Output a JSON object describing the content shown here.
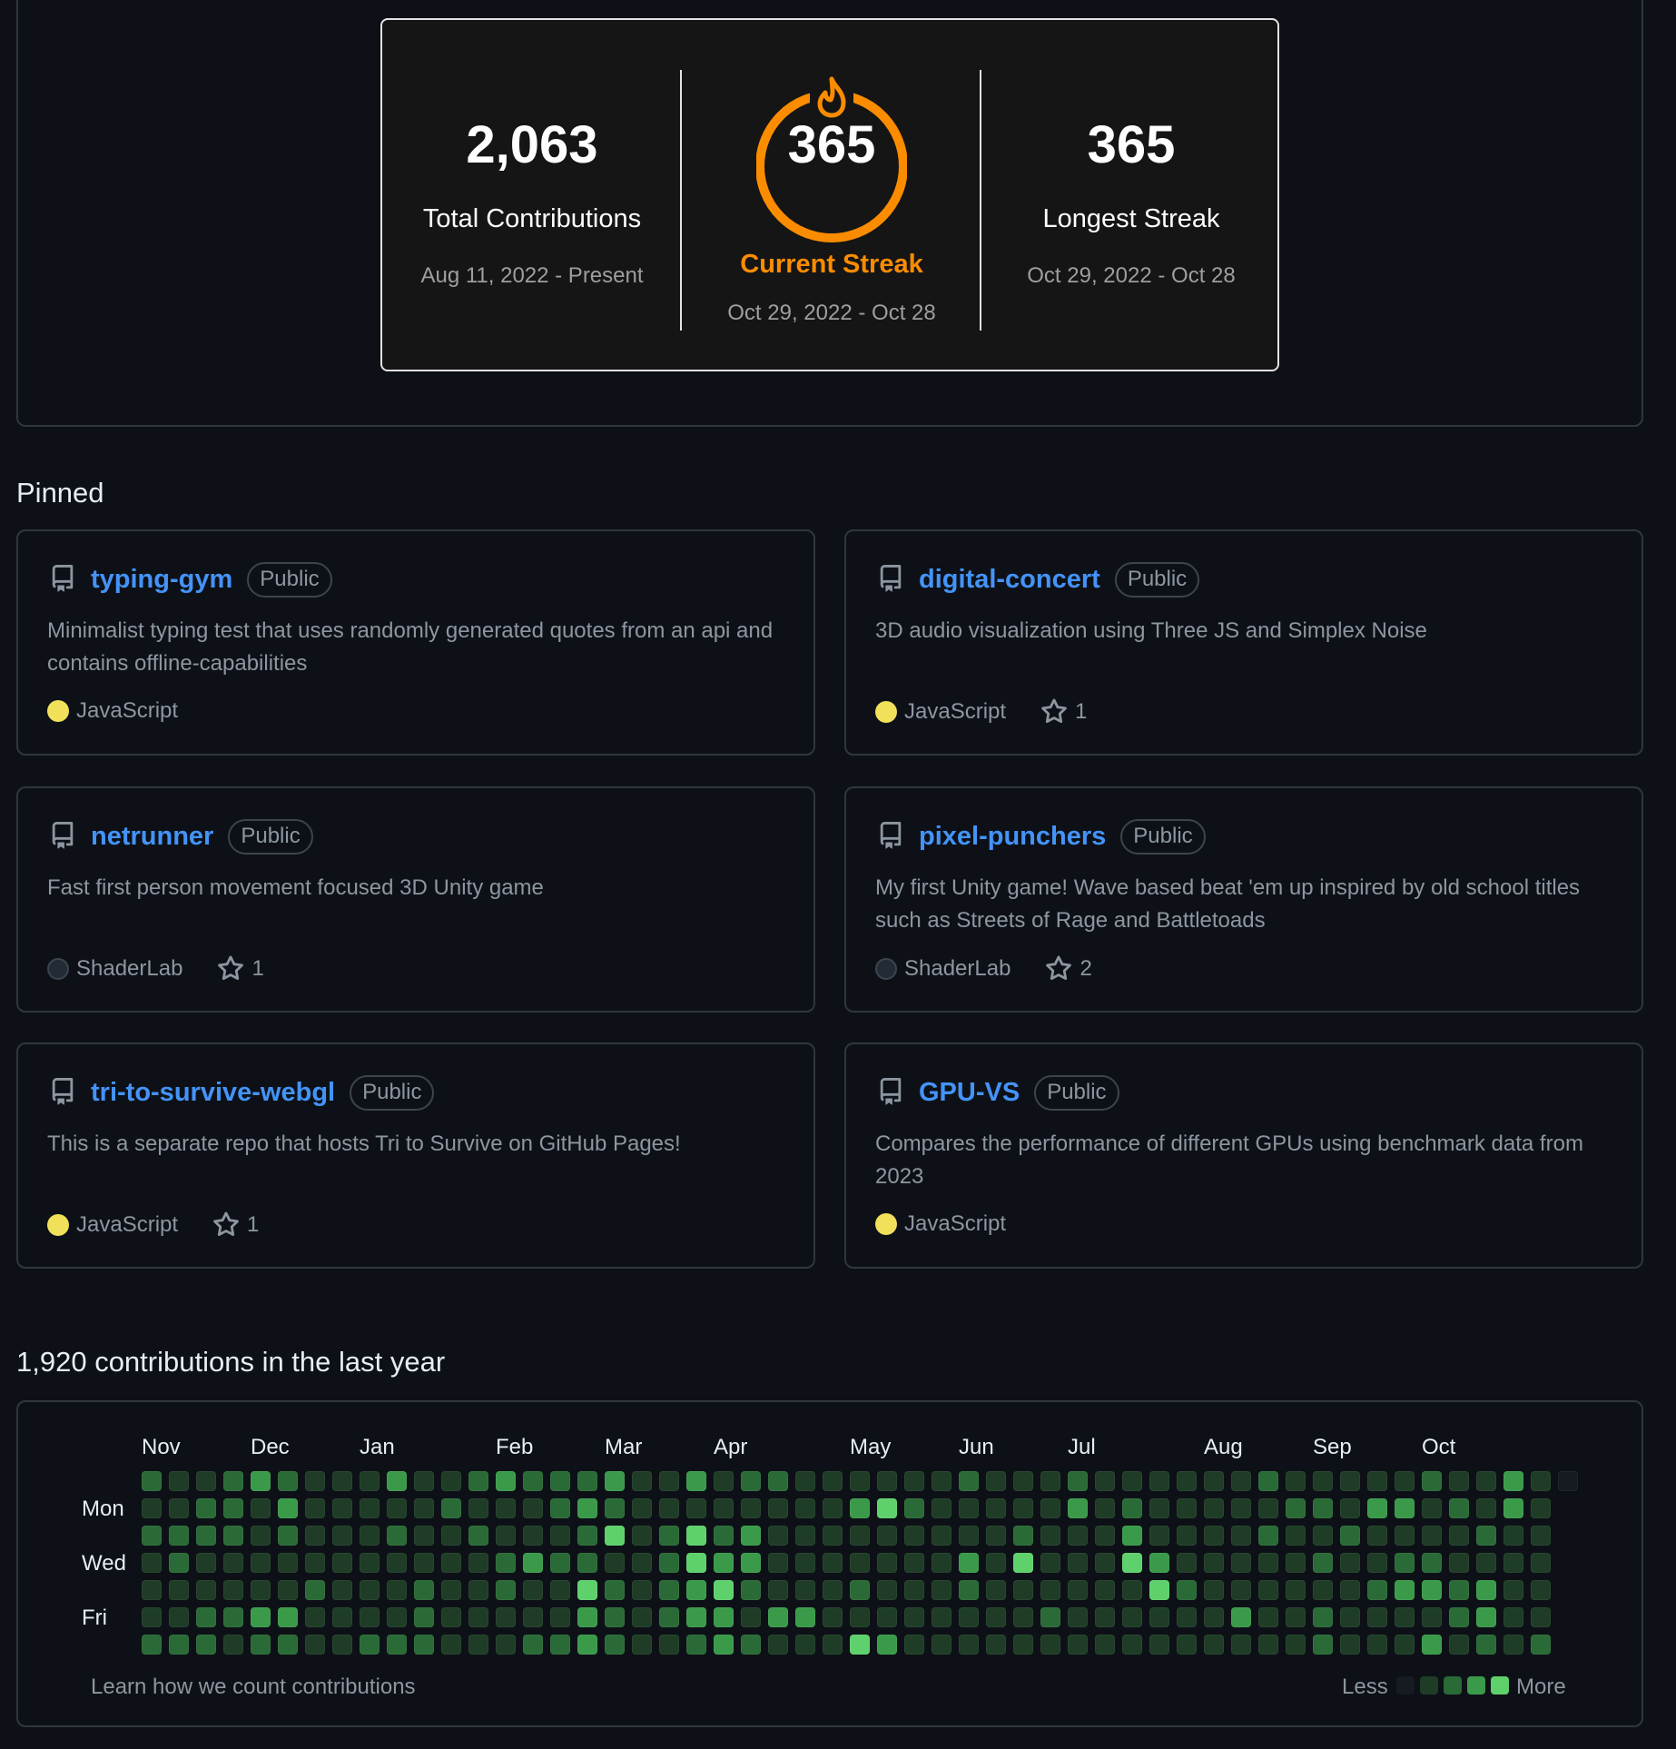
{
  "streak": {
    "total": {
      "value": "2,063",
      "label": "Total Contributions",
      "range": "Aug 11, 2022 - Present"
    },
    "current": {
      "value": "365",
      "label": "Current Streak",
      "range": "Oct 29, 2022 - Oct 28"
    },
    "longest": {
      "value": "365",
      "label": "Longest Streak",
      "range": "Oct 29, 2022 - Oct 28"
    },
    "colors": {
      "ring": "#fb8c00",
      "card_bg": "#151515",
      "card_border": "#e4e2e2"
    }
  },
  "pinned": {
    "title": "Pinned",
    "repos": [
      {
        "name": "typing-gym",
        "visibility": "Public",
        "description": "Minimalist typing test that uses randomly generated quotes from an api and contains offline-capabilities",
        "language": "JavaScript",
        "stars": ""
      },
      {
        "name": "digital-concert",
        "visibility": "Public",
        "description": "3D audio visualization using Three JS and Simplex Noise",
        "language": "JavaScript",
        "stars": "1"
      },
      {
        "name": "netrunner",
        "visibility": "Public",
        "description": "Fast first person movement focused 3D Unity game",
        "language": "ShaderLab",
        "stars": "1"
      },
      {
        "name": "pixel-punchers",
        "visibility": "Public",
        "description": "My first Unity game! Wave based beat 'em up inspired by old school titles such as Streets of Rage and Battletoads",
        "language": "ShaderLab",
        "stars": "2"
      },
      {
        "name": "tri-to-survive-webgl",
        "visibility": "Public",
        "description": "This is a separate repo that hosts Tri to Survive on GitHub Pages!",
        "language": "JavaScript",
        "stars": "1"
      },
      {
        "name": "GPU-VS",
        "visibility": "Public",
        "description": "Compares the performance of different GPUs using benchmark data from 2023",
        "language": "JavaScript",
        "stars": ""
      }
    ]
  },
  "contributions": {
    "title": "1,920 contributions in the last year",
    "months": [
      "Nov",
      "Dec",
      "Jan",
      "Feb",
      "Mar",
      "Apr",
      "May",
      "Jun",
      "Jul",
      "Aug",
      "Sep",
      "Oct"
    ],
    "month_start_weeks": [
      0,
      4,
      8,
      13,
      17,
      21,
      26,
      30,
      34,
      39,
      43,
      47
    ],
    "days": [
      "Mon",
      "Wed",
      "Fri"
    ],
    "learn_link": "Learn how we count contributions",
    "legend_less": "Less",
    "legend_more": "More",
    "level_colors": [
      "#161b22",
      "#1f3d26",
      "#2a6a36",
      "#3a9a4a",
      "#5fd16c"
    ],
    "weeks": [
      [
        2,
        1,
        2,
        1,
        1,
        1,
        2
      ],
      [
        1,
        1,
        2,
        2,
        1,
        1,
        2
      ],
      [
        1,
        2,
        2,
        1,
        1,
        2,
        2
      ],
      [
        2,
        2,
        2,
        1,
        1,
        2,
        1
      ],
      [
        3,
        1,
        1,
        1,
        1,
        3,
        2
      ],
      [
        2,
        3,
        2,
        1,
        1,
        3,
        2
      ],
      [
        1,
        1,
        1,
        1,
        2,
        1,
        1
      ],
      [
        1,
        1,
        1,
        1,
        1,
        1,
        1
      ],
      [
        1,
        1,
        1,
        1,
        1,
        1,
        2
      ],
      [
        3,
        1,
        2,
        1,
        1,
        1,
        2
      ],
      [
        1,
        1,
        1,
        1,
        2,
        2,
        2
      ],
      [
        1,
        2,
        1,
        1,
        1,
        1,
        1
      ],
      [
        2,
        1,
        2,
        1,
        1,
        1,
        1
      ],
      [
        3,
        1,
        1,
        2,
        2,
        1,
        1
      ],
      [
        2,
        1,
        1,
        3,
        1,
        1,
        2
      ],
      [
        2,
        2,
        1,
        2,
        1,
        1,
        2
      ],
      [
        2,
        3,
        2,
        2,
        4,
        3,
        3
      ],
      [
        3,
        2,
        4,
        1,
        2,
        2,
        2
      ],
      [
        1,
        1,
        1,
        1,
        1,
        1,
        1
      ],
      [
        1,
        1,
        2,
        2,
        2,
        2,
        1
      ],
      [
        3,
        1,
        4,
        4,
        3,
        3,
        2
      ],
      [
        1,
        1,
        2,
        3,
        4,
        3,
        3
      ],
      [
        2,
        1,
        3,
        3,
        2,
        1,
        2
      ],
      [
        2,
        1,
        1,
        1,
        1,
        3,
        1
      ],
      [
        1,
        1,
        1,
        1,
        1,
        3,
        1
      ],
      [
        1,
        1,
        1,
        1,
        1,
        1,
        1
      ],
      [
        1,
        3,
        1,
        1,
        2,
        1,
        4
      ],
      [
        1,
        4,
        1,
        1,
        1,
        1,
        3
      ],
      [
        1,
        2,
        1,
        1,
        1,
        1,
        1
      ],
      [
        1,
        1,
        1,
        1,
        1,
        1,
        1
      ],
      [
        2,
        1,
        1,
        3,
        2,
        1,
        1
      ],
      [
        1,
        1,
        1,
        1,
        1,
        1,
        1
      ],
      [
        1,
        1,
        2,
        4,
        1,
        1,
        1
      ],
      [
        1,
        1,
        1,
        1,
        1,
        2,
        1
      ],
      [
        2,
        3,
        1,
        1,
        1,
        1,
        1
      ],
      [
        1,
        1,
        1,
        1,
        1,
        1,
        1
      ],
      [
        1,
        2,
        3,
        4,
        1,
        1,
        1
      ],
      [
        1,
        1,
        1,
        3,
        4,
        1,
        1
      ],
      [
        1,
        1,
        1,
        1,
        2,
        1,
        1
      ],
      [
        1,
        1,
        1,
        1,
        1,
        1,
        1
      ],
      [
        1,
        1,
        1,
        1,
        1,
        3,
        1
      ],
      [
        2,
        1,
        2,
        1,
        1,
        1,
        1
      ],
      [
        1,
        2,
        1,
        1,
        1,
        1,
        1
      ],
      [
        1,
        2,
        1,
        2,
        1,
        2,
        2
      ],
      [
        1,
        1,
        2,
        1,
        1,
        1,
        1
      ],
      [
        1,
        3,
        1,
        1,
        2,
        1,
        1
      ],
      [
        1,
        3,
        1,
        2,
        3,
        1,
        1
      ],
      [
        2,
        1,
        1,
        2,
        3,
        1,
        3
      ],
      [
        1,
        2,
        1,
        1,
        2,
        2,
        1
      ],
      [
        1,
        1,
        2,
        1,
        3,
        3,
        2
      ],
      [
        3,
        3,
        1,
        1,
        1,
        1,
        1
      ],
      [
        1,
        1,
        1,
        1,
        1,
        1,
        2
      ],
      [
        0,
        null,
        null,
        null,
        null,
        null,
        null
      ]
    ]
  }
}
